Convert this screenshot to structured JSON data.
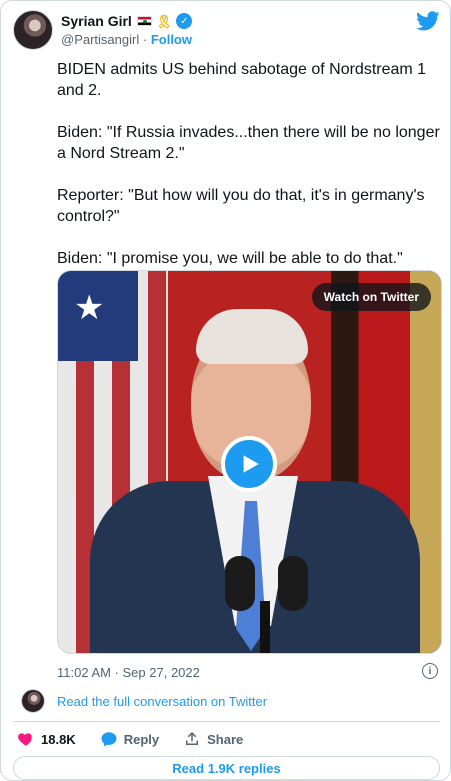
{
  "author": {
    "display_name": "Syrian Girl",
    "handle": "@Partisangirl",
    "follow_label": "Follow",
    "separator": "·"
  },
  "tweet": {
    "paragraphs": [
      "BIDEN admits US behind sabotage of Nordstream 1 and 2.",
      "Biden: \"If Russia invades...then there will be no longer a Nord Stream 2.\"",
      "Reporter: \"But how will you do that, it's in germany's control?\"",
      "Biden: \"I promise you, we will be able to do that.\""
    ],
    "timestamp": "11:02 AM · Sep 27, 2022"
  },
  "media": {
    "watch_label": "Watch on Twitter"
  },
  "conversation": {
    "link_label": "Read the full conversation on Twitter"
  },
  "actions": {
    "like_count": "18.8K",
    "reply_label": "Reply",
    "share_label": "Share"
  },
  "replies": {
    "button_label": "Read 1.9K replies"
  },
  "colors": {
    "accent": "#1d9bf0",
    "like": "#f91880",
    "text": "#0f1419",
    "muted": "#536471"
  },
  "icons": {
    "brand": "twitter-bird-icon",
    "verified": "verified-badge-icon",
    "play": "play-icon",
    "info": "info-icon",
    "like": "heart-icon",
    "reply": "reply-bubble-icon",
    "share": "share-icon"
  }
}
